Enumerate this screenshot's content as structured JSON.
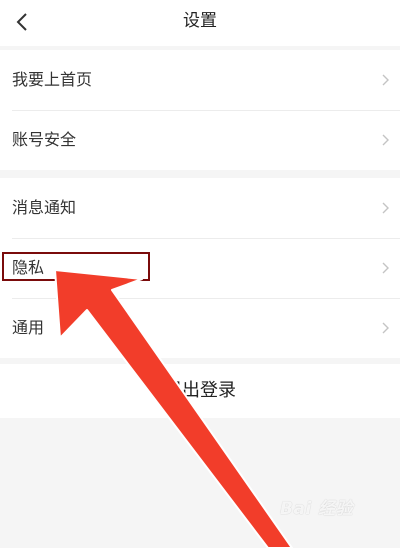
{
  "header": {
    "title": "设置",
    "back_icon": "chevron-left-icon"
  },
  "groups": [
    {
      "items": [
        {
          "label": "我要上首页"
        },
        {
          "label": "账号安全"
        }
      ]
    },
    {
      "items": [
        {
          "label": "消息通知"
        },
        {
          "label": "隐私"
        },
        {
          "label": "通用"
        }
      ]
    }
  ],
  "logout": {
    "label": "退出登录"
  },
  "annotation": {
    "highlight_color": "#7a0b0b",
    "arrow_color": "#f23d2a"
  },
  "watermark": {
    "text": "Bai 经验"
  },
  "colors": {
    "background": "#f5f5f5",
    "card": "#ffffff",
    "chevron": "#c4c4c4"
  }
}
